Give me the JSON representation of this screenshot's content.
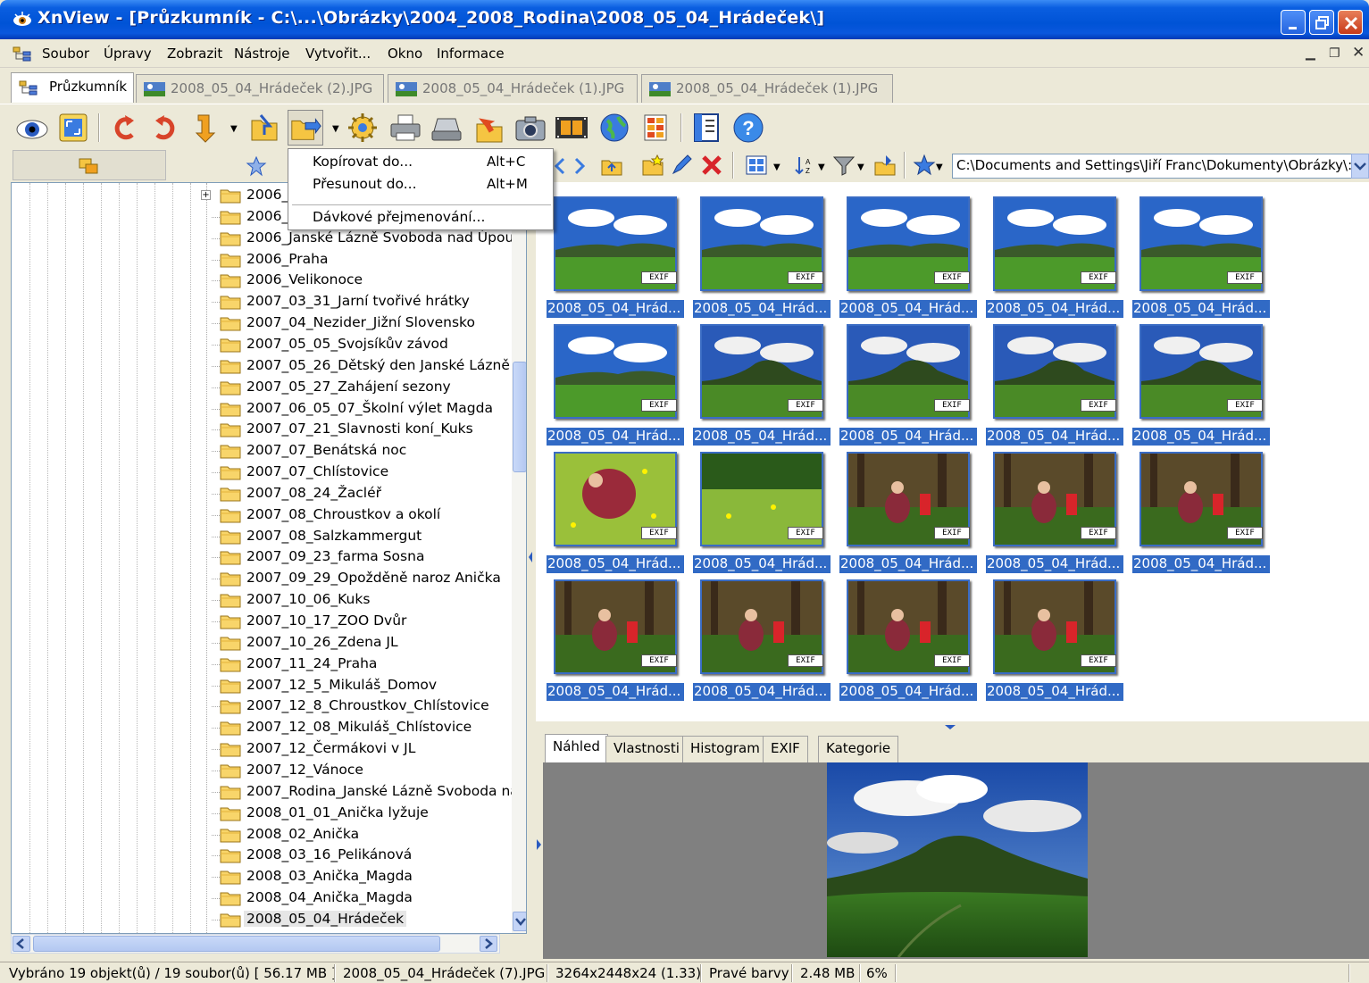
{
  "window": {
    "title": "XnView - [Průzkumník - C:\\...\\Obrázky\\2004_2008_Rodina\\2008_05_04_Hrádeček\\]"
  },
  "menubar": {
    "items": [
      "Soubor",
      "Úpravy",
      "Zobrazit",
      "Nástroje",
      "Vytvořit...",
      "Okno",
      "Informace"
    ]
  },
  "doc_tabs": [
    {
      "label": "Průzkumník"
    },
    {
      "label": "2008_05_04_Hrádeček (2).JPG"
    },
    {
      "label": "2008_05_04_Hrádeček (1).JPG"
    },
    {
      "label": "2008_05_04_Hrádeček (1).JPG"
    }
  ],
  "popup_menu": {
    "items": [
      {
        "label": "Kopírovat do...",
        "shortcut": "Alt+C"
      },
      {
        "label": "Přesunout do...",
        "shortcut": "Alt+M"
      },
      {
        "label": "Dávkové přejmenování...",
        "shortcut": ""
      }
    ]
  },
  "path_bar": {
    "value": "C:\\Documents and Settings\\Jiří Franc\\Dokumenty\\Obrázky\\:"
  },
  "tree": {
    "items": [
      {
        "label": "2006_",
        "expander": true
      },
      {
        "label": "2006_"
      },
      {
        "label": "2006_Janské Lázně  Svoboda nad Úpou"
      },
      {
        "label": "2006_Praha"
      },
      {
        "label": "2006_Velikonoce"
      },
      {
        "label": "2007_03_31_Jarní tvořivé hrátky"
      },
      {
        "label": "2007_04_Nezider_Jižní Slovensko"
      },
      {
        "label": "2007_05_05_Svojsíkův závod"
      },
      {
        "label": "2007_05_26_Dětský den Janské Lázně"
      },
      {
        "label": "2007_05_27_Zahájení sezony"
      },
      {
        "label": "2007_06_05_07_Školní výlet Magda"
      },
      {
        "label": "2007_07_21_Slavnosti koní_Kuks"
      },
      {
        "label": "2007_07_Benátská noc"
      },
      {
        "label": "2007_07_Chlístovice"
      },
      {
        "label": "2007_08_24_Žacléř"
      },
      {
        "label": "2007_08_Chroustkov a okolí"
      },
      {
        "label": "2007_08_Salzkammergut"
      },
      {
        "label": "2007_09_23_farma Sosna"
      },
      {
        "label": "2007_09_29_Opožděně naroz Anička"
      },
      {
        "label": "2007_10_06_Kuks"
      },
      {
        "label": "2007_10_17_ZOO Dvůr"
      },
      {
        "label": "2007_10_26_Zdena JL"
      },
      {
        "label": "2007_11_24_Praha"
      },
      {
        "label": "2007_12_5_Mikuláš_Domov"
      },
      {
        "label": "2007_12_8_Chroustkov_Chlístovice"
      },
      {
        "label": "2007_12_08_Mikuláš_Chlístovice"
      },
      {
        "label": "2007_12_Čermákovi v JL"
      },
      {
        "label": "2007_12_Vánoce"
      },
      {
        "label": "2007_Rodina_Janské Lázně Svoboda na"
      },
      {
        "label": "2008_01_01_Anička lyžuje"
      },
      {
        "label": "2008_02_Anička"
      },
      {
        "label": "2008_03_16_Pelikánová"
      },
      {
        "label": "2008_03_Anička_Magda"
      },
      {
        "label": "2008_04_Anička_Magda"
      },
      {
        "label": "2008_05_04_Hrádeček",
        "selected": true
      }
    ]
  },
  "thumbnails": {
    "badge": "EXIF",
    "items": [
      {
        "caption": "2008_05_04_Hrád...",
        "scene": "meadow"
      },
      {
        "caption": "2008_05_04_Hrád...",
        "scene": "meadow"
      },
      {
        "caption": "2008_05_04_Hrád...",
        "scene": "meadow"
      },
      {
        "caption": "2008_05_04_Hrád...",
        "scene": "meadow"
      },
      {
        "caption": "2008_05_04_Hrád...",
        "scene": "meadow"
      },
      {
        "caption": "2008_05_04_Hrád...",
        "scene": "meadow"
      },
      {
        "caption": "2008_05_04_Hrád...",
        "scene": "hill"
      },
      {
        "caption": "2008_05_04_Hrád...",
        "scene": "hill"
      },
      {
        "caption": "2008_05_04_Hrád...",
        "scene": "hill"
      },
      {
        "caption": "2008_05_04_Hrád...",
        "scene": "hill"
      },
      {
        "caption": "2008_05_04_Hrád...",
        "scene": "flowers"
      },
      {
        "caption": "2008_05_04_Hrád...",
        "scene": "forest"
      },
      {
        "caption": "2008_05_04_Hrád...",
        "scene": "people"
      },
      {
        "caption": "2008_05_04_Hrád...",
        "scene": "people"
      },
      {
        "caption": "2008_05_04_Hrád...",
        "scene": "people"
      },
      {
        "caption": "2008_05_04_Hrád...",
        "scene": "people"
      },
      {
        "caption": "2008_05_04_Hrád...",
        "scene": "people"
      },
      {
        "caption": "2008_05_04_Hrád...",
        "scene": "people"
      },
      {
        "caption": "2008_05_04_Hrád...",
        "scene": "people"
      }
    ]
  },
  "preview_tabs": [
    "Náhled",
    "Vlastnosti",
    "Histogram",
    "EXIF",
    "Kategorie"
  ],
  "status": {
    "selection": "Vybráno 19 objekt(ů) / 19 soubor(ů)  [ 56.17 MB ]",
    "file": "2008_05_04_Hrádeček (7).JPG",
    "dimensions": "3264x2448x24 (1.33)",
    "color": "Pravé barvy",
    "size": "2.48 MB",
    "zoom": "6%"
  },
  "colors": {
    "selection_blue": "#316ac5",
    "titlebar_blue": "#0053d6",
    "panel_bg": "#ece9d8"
  }
}
